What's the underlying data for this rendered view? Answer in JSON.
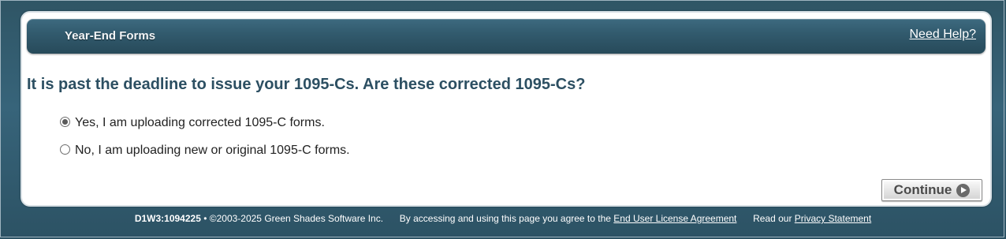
{
  "header": {
    "title": "Year-End Forms",
    "help_link": "Need Help?"
  },
  "question": "It is past the deadline to issue your 1095-Cs. Are these corrected 1095-Cs?",
  "options": [
    {
      "label": "Yes, I am uploading corrected 1095-C forms.",
      "selected": true
    },
    {
      "label": "No, I am uploading new or original 1095-C forms.",
      "selected": false
    }
  ],
  "continue_button": {
    "label": "Continue",
    "icon": "arrow-circle-right-icon"
  },
  "footer": {
    "build_id": "D1W3:1094225",
    "copyright": "• ©2003-2025 Green Shades Software Inc.",
    "agreement_text": "By accessing and using this page you agree to the",
    "eula_link": "End User License Agreement",
    "privacy_text": "Read our",
    "privacy_link": "Privacy Statement"
  },
  "colors": {
    "background": "#37647a",
    "header_bar": "#325b6e",
    "question_text": "#2c4f62",
    "panel": "#ffffff"
  }
}
